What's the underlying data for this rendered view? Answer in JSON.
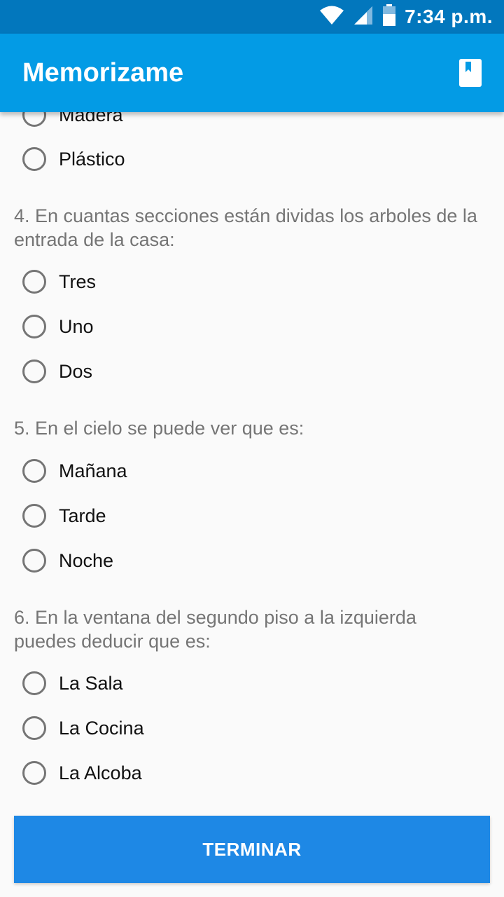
{
  "status_bar": {
    "time": "7:34 p.m.",
    "icons": [
      "wifi-icon",
      "signal-icon",
      "battery-icon"
    ]
  },
  "app_bar": {
    "title": "Memorizame",
    "action_icon": "book-icon"
  },
  "colors": {
    "status_bar": "#0277bd",
    "app_bar": "#039be5",
    "button": "#1e88e5",
    "question_text": "#757575",
    "radio_border": "#757575",
    "background": "#fafafa"
  },
  "questions": [
    {
      "text": "",
      "options": [
        "Madera",
        "Plástico"
      ]
    },
    {
      "text": "4. En cuantas secciones están dividas los arboles de la entrada de la casa:",
      "options": [
        "Tres",
        "Uno",
        "Dos"
      ]
    },
    {
      "text": "5. En el cielo se puede ver que es:",
      "options": [
        "Mañana",
        "Tarde",
        "Noche"
      ]
    },
    {
      "text": "6. En la ventana del segundo piso a la izquierda puedes deducir que es:",
      "options": [
        "La Sala",
        "La Cocina",
        "La Alcoba"
      ]
    }
  ],
  "finish_button": {
    "label": "TERMINAR"
  }
}
